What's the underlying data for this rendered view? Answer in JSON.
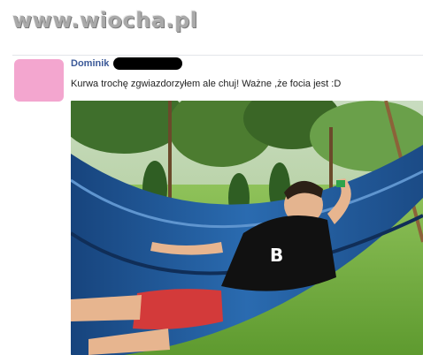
{
  "watermark": {
    "text": "www.wiocha.pl"
  },
  "post": {
    "author": "Dominik",
    "message": "Kurwa trochę zgwiazdorzyłem ale chuj! Ważne ,że focia jest :D"
  },
  "photo": {
    "shirt_text": "B"
  },
  "colors": {
    "link": "#3b5998",
    "text": "#222222",
    "avatar": "#f3a6cf",
    "grass": "#6fae3b",
    "hammock": "#1e3f7a"
  }
}
